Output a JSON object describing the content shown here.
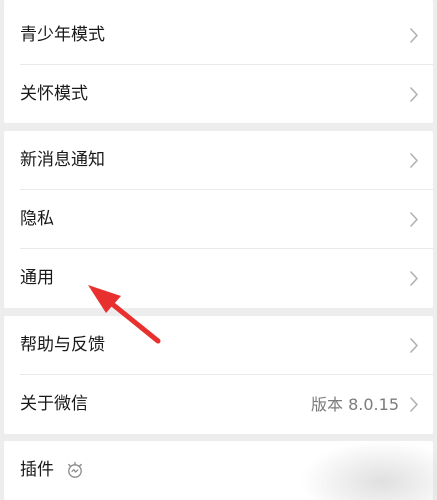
{
  "settings": {
    "group1": [
      {
        "label": "青少年模式"
      },
      {
        "label": "关怀模式"
      }
    ],
    "group2": [
      {
        "label": "新消息通知"
      },
      {
        "label": "隐私"
      },
      {
        "label": "通用"
      }
    ],
    "group3": [
      {
        "label": "帮助与反馈"
      },
      {
        "label": "关于微信",
        "value": "版本 8.0.15"
      }
    ],
    "group4": [
      {
        "label": "插件"
      }
    ]
  },
  "icons": {
    "chevron": "chevron-right-icon",
    "plugin": "plugin-icon"
  },
  "colors": {
    "background": "#ededed",
    "row_background": "#ffffff",
    "label_text": "#191919",
    "secondary_text": "#7b7b7b",
    "chevron": "#b2b2b2",
    "annotation_arrow": "#e8312f"
  }
}
